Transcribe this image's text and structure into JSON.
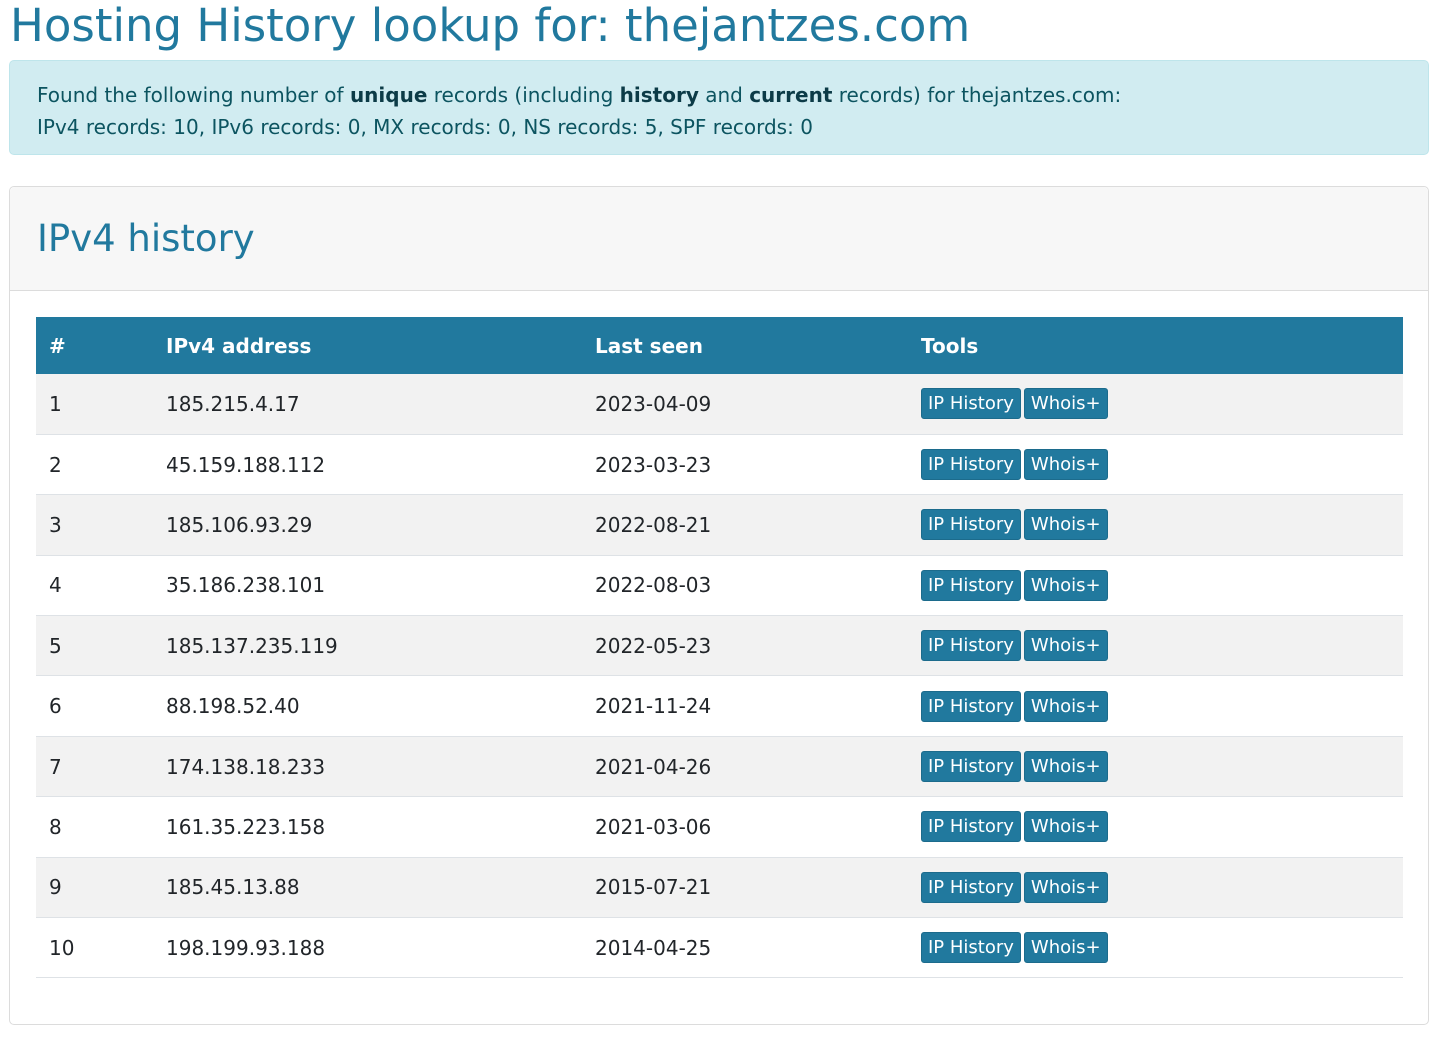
{
  "page": {
    "title": "Hosting History lookup for: thejantzes.com"
  },
  "summary": {
    "line1_pre": "Found the following number of ",
    "unique": "unique",
    "line1_mid1": " records (including ",
    "history": "history",
    "line1_mid2": " and ",
    "current": "current",
    "line1_post": " records) for thejantzes.com:",
    "line2": "IPv4 records: 10, IPv6 records: 0, MX records: 0, NS records: 5, SPF records: 0"
  },
  "ipv4": {
    "heading": "IPv4 history",
    "columns": [
      "#",
      "IPv4 address",
      "Last seen",
      "Tools"
    ],
    "button_ip_history": "IP History",
    "button_whois": "Whois+",
    "rows": [
      {
        "num": "1",
        "ip": "185.215.4.17",
        "last_seen": "2023-04-09"
      },
      {
        "num": "2",
        "ip": "45.159.188.112",
        "last_seen": "2023-03-23"
      },
      {
        "num": "3",
        "ip": "185.106.93.29",
        "last_seen": "2022-08-21"
      },
      {
        "num": "4",
        "ip": "35.186.238.101",
        "last_seen": "2022-08-03"
      },
      {
        "num": "5",
        "ip": "185.137.235.119",
        "last_seen": "2022-05-23"
      },
      {
        "num": "6",
        "ip": "88.198.52.40",
        "last_seen": "2021-11-24"
      },
      {
        "num": "7",
        "ip": "174.138.18.233",
        "last_seen": "2021-04-26"
      },
      {
        "num": "8",
        "ip": "161.35.223.158",
        "last_seen": "2021-03-06"
      },
      {
        "num": "9",
        "ip": "185.45.13.88",
        "last_seen": "2015-07-21"
      },
      {
        "num": "10",
        "ip": "198.199.93.188",
        "last_seen": "2014-04-25"
      }
    ]
  },
  "colors": {
    "primary": "#21799e",
    "alert_bg": "#d1ecf1",
    "alert_text": "#0c5460"
  }
}
